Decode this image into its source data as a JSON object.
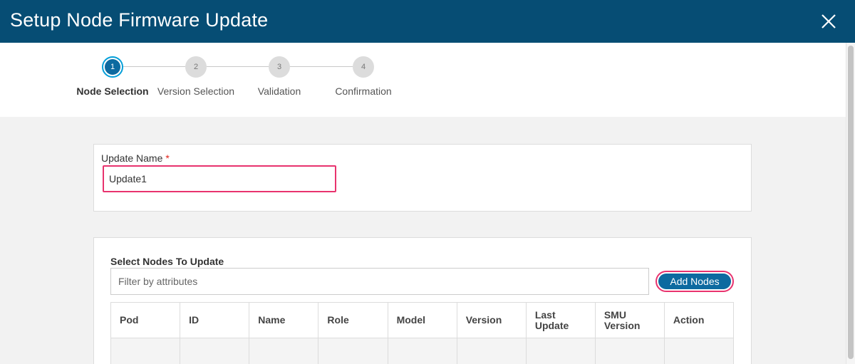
{
  "dialog": {
    "title": "Setup Node Firmware Update"
  },
  "wizard": {
    "steps": [
      {
        "number": "1",
        "label": "Node Selection",
        "active": true
      },
      {
        "number": "2",
        "label": "Version Selection",
        "active": false
      },
      {
        "number": "3",
        "label": "Validation",
        "active": false
      },
      {
        "number": "4",
        "label": "Confirmation",
        "active": false
      }
    ]
  },
  "update_name": {
    "label": "Update Name",
    "required_marker": "*",
    "value": "Update1"
  },
  "nodes": {
    "title": "Select Nodes To Update",
    "filter_placeholder": "Filter by attributes",
    "add_button": "Add Nodes",
    "columns": [
      "Pod",
      "ID",
      "Name",
      "Role",
      "Model",
      "Version",
      "Last Update",
      "SMU Version",
      "Action"
    ]
  },
  "colors": {
    "header_bg": "#064d74",
    "accent": "#0d6aa0",
    "highlight": "#e8336e",
    "required": "#e2231a"
  }
}
